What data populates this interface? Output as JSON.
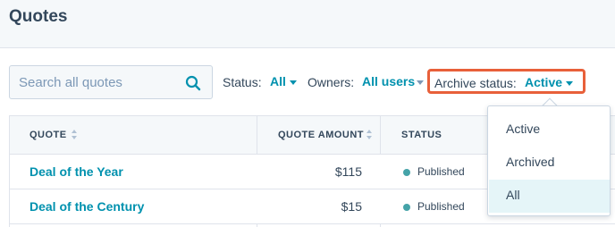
{
  "page": {
    "title": "Quotes"
  },
  "search": {
    "placeholder": "Search all quotes",
    "icon": "search-icon"
  },
  "filters": {
    "status": {
      "label": "Status:",
      "value": "All"
    },
    "owners": {
      "label": "Owners:",
      "value": "All users"
    },
    "archive": {
      "label": "Archive status:",
      "value": "Active"
    }
  },
  "table": {
    "columns": [
      "QUOTE",
      "QUOTE AMOUNT",
      "STATUS"
    ],
    "rows": [
      {
        "name": "Deal of the Year",
        "amount": "$115",
        "status": "Published"
      },
      {
        "name": "Deal of the Century",
        "amount": "$15",
        "status": "Published"
      }
    ]
  },
  "archive_menu": {
    "options": [
      "Active",
      "Archived",
      "All"
    ],
    "highlighted": "All"
  },
  "colors": {
    "accent": "#0091ae",
    "highlight_border": "#e8603a",
    "published_dot": "#45a3a8",
    "menu_highlight": "#e5f5f8"
  }
}
